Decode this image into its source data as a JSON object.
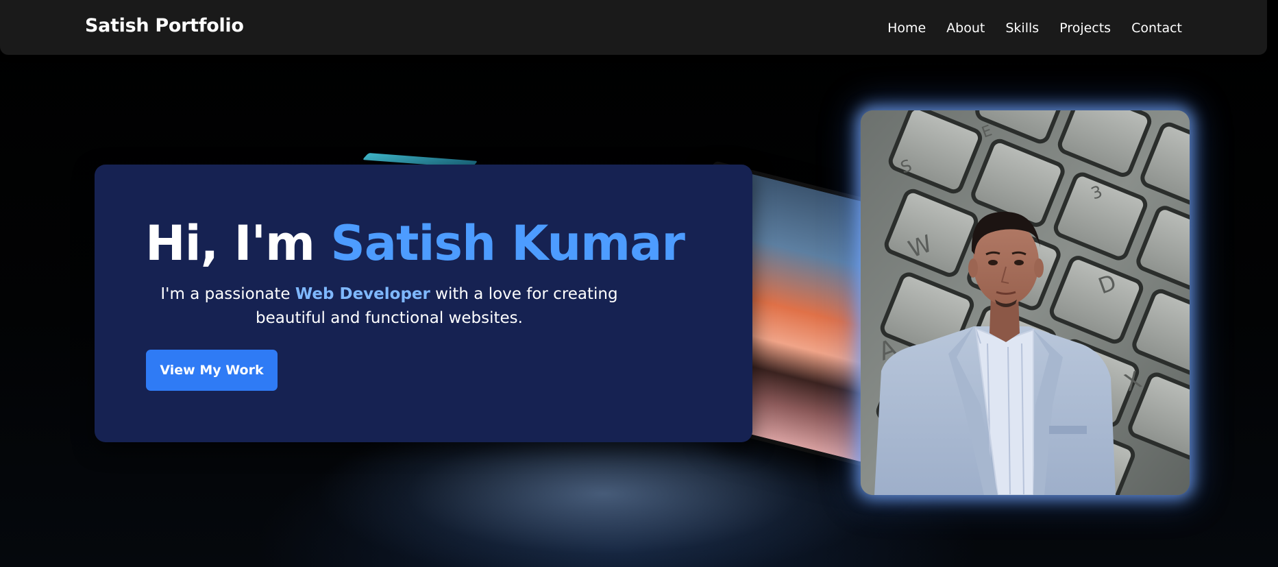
{
  "navbar": {
    "brand": "Satish Portfolio",
    "links": [
      "Home",
      "About",
      "Skills",
      "Projects",
      "Contact"
    ]
  },
  "hero": {
    "greeting": "Hi, I'm ",
    "name": "Satish Kumar",
    "subtitle_prefix": "I'm a passionate ",
    "subtitle_highlight": "Web Developer",
    "subtitle_suffix": " with a love for creating beautiful and functional websites.",
    "cta_label": "View My Work"
  },
  "photo": {
    "keys": [
      "W",
      "D",
      "A",
      "X",
      "S",
      "3",
      "E"
    ]
  },
  "colors": {
    "background": "#000000",
    "navbar": "#1a1a1a",
    "card": "#162252",
    "accent": "#4d9cff",
    "highlight": "#7fb8ff",
    "button": "#2f7bf5",
    "photo_glow": "#78aaff"
  }
}
